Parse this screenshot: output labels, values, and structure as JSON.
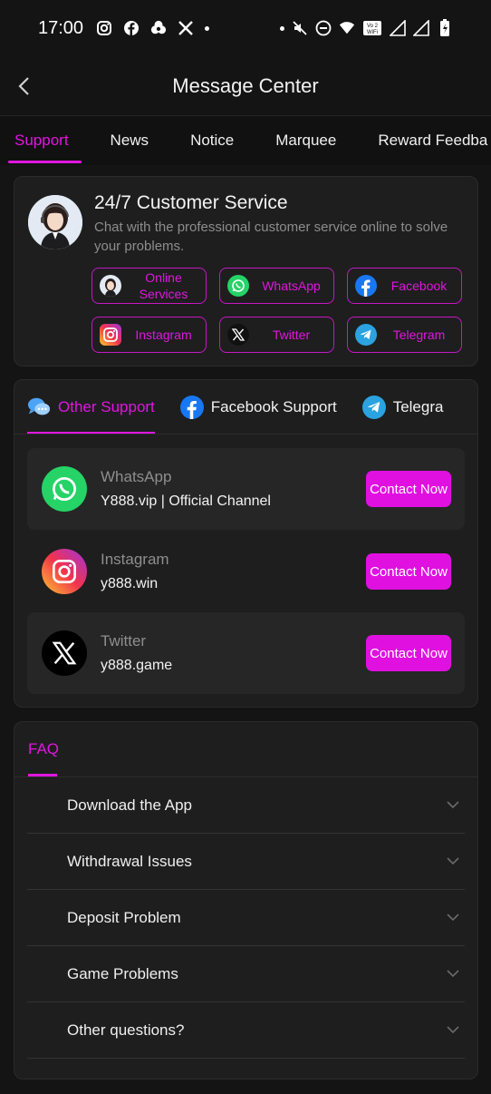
{
  "status_bar": {
    "time": "17:00",
    "volte_label": "Vo 2 WiFi"
  },
  "header": {
    "title": "Message Center"
  },
  "tabs": [
    {
      "label": "Support",
      "active": true
    },
    {
      "label": "News",
      "active": false
    },
    {
      "label": "Notice",
      "active": false
    },
    {
      "label": "Marquee",
      "active": false
    },
    {
      "label": "Reward Feedba",
      "active": false
    }
  ],
  "customer_service": {
    "title": "24/7 Customer Service",
    "description": "Chat with the professional customer service online to solve your problems.",
    "buttons": [
      {
        "label": "Online Services",
        "icon": "agent-avatar-icon"
      },
      {
        "label": "WhatsApp",
        "icon": "whatsapp-icon"
      },
      {
        "label": "Facebook",
        "icon": "facebook-icon"
      },
      {
        "label": "Instagram",
        "icon": "instagram-icon"
      },
      {
        "label": "Twitter",
        "icon": "x-twitter-icon"
      },
      {
        "label": "Telegram",
        "icon": "telegram-icon"
      }
    ]
  },
  "other_support": {
    "tabs": [
      {
        "label": "Other Support",
        "icon": "chat-bubbles-icon",
        "active": true
      },
      {
        "label": "Facebook Support",
        "icon": "facebook-icon",
        "active": false
      },
      {
        "label": "Telegra",
        "icon": "telegram-icon",
        "active": false
      }
    ],
    "items": [
      {
        "name": "WhatsApp",
        "value": "Y888.vip | Official Channel",
        "button": "Contact Now",
        "icon": "whatsapp-icon"
      },
      {
        "name": "Instagram",
        "value": "y888.win",
        "button": "Contact Now",
        "icon": "instagram-icon"
      },
      {
        "name": "Twitter",
        "value": "y888.game",
        "button": "Contact Now",
        "icon": "x-twitter-icon"
      }
    ]
  },
  "faq": {
    "title": "FAQ",
    "items": [
      {
        "question": "Download the App"
      },
      {
        "question": "Withdrawal Issues"
      },
      {
        "question": "Deposit Problem"
      },
      {
        "question": "Game Problems"
      },
      {
        "question": "Other questions?"
      }
    ]
  },
  "colors": {
    "accent": "#e016e0",
    "background": "#141414",
    "card": "#1e1e1e"
  }
}
